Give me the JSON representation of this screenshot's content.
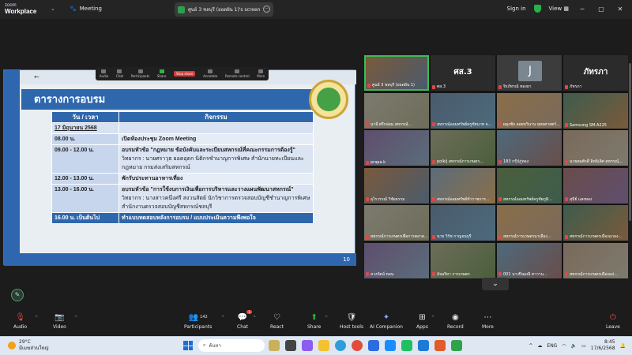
{
  "titlebar": {
    "logo_line1": "zoom",
    "logo_line2": "Workplace",
    "meeting_label": "Meeting",
    "share_tab": "ศูนย์ 3 ชลบุรี (ยอดฝัน 1)'s screen",
    "signin": "Sign in",
    "view": "View"
  },
  "slide": {
    "title": "ตารางการอบรม",
    "headers": [
      "วัน / เวลา",
      "กิจกรรม"
    ],
    "date": "17 มิถุนายน 2568",
    "page_number": "10",
    "rows": [
      {
        "time": "08.00 น.",
        "activity": "เปิดห้องประชุม Zoom Meeting",
        "detail": ""
      },
      {
        "time": "09.00 - 12.00 น.",
        "activity": "อบรมหัวข้อ \"กฎหมาย ข้อบังคับและระเบียบสหกรณ์ที่คณะกรรมการต้องรู้\"",
        "detail": "วิทยากร : นายศราวุธ ยอดอุดก นิติกรชำนาญการพิเศษ สำนักนายทะเบียนและกฎหมาย กรมส่งเสริมสหกรณ์"
      },
      {
        "time": "12.00 - 13.00 น.",
        "activity": "พักรับประทานอาหารเที่ยง",
        "detail": ""
      },
      {
        "time": "13.00 - 16.00 น.",
        "activity": "อบรมหัวข้อ \"การใช้งบการเงินเพื่อการบริหารและวางแผนพัฒนาสหกรณ์\"",
        "detail": "วิทยากร : นางสาวคนึงศรี สงวนสัตย์ นักวิชาการตรวจสอบบัญชีชำนาญการพิเศษ สำนักงานตรวจสอบบัญชีสหกรณ์ชลบุรี"
      },
      {
        "time": "16.00 น. เป็นต้นไป",
        "activity": "ทำแบบทดสอบหลังการอบรม / แบบประเมินความพึงพอใจ",
        "detail": ""
      }
    ]
  },
  "sharebar": {
    "items": [
      "Audio",
      "Chat",
      "Participants",
      "Share",
      "Stop share",
      "Annotate",
      "Remote control",
      "More"
    ]
  },
  "gallery": {
    "tiles": [
      {
        "name": "ศูนย์ 3 ชลบุรี (ยอดฝัน 1)",
        "big": "",
        "kind": "video"
      },
      {
        "name": "ศส.3",
        "big": "ศส.3",
        "kind": "text"
      },
      {
        "name": "จิรภัทรณ์ ทองยา",
        "big": "J",
        "kind": "avatar"
      },
      {
        "name": "ภัทรภา",
        "big": "ภัทรภา",
        "kind": "text"
      },
      {
        "name": "นาลี ศรีกล่อม สหกรณ์...",
        "big": "",
        "kind": "video"
      },
      {
        "name": "สหกรณ์ออมทรัพย์ครูชัยนาท จ...",
        "big": "",
        "kind": "video"
      },
      {
        "name": "ผดุงชัย ลอยทวินาน ยุทธศาสตร์...",
        "big": "",
        "kind": "video"
      },
      {
        "name": "Samsung SM-A225",
        "big": "",
        "kind": "video"
      },
      {
        "name": "prapa.k",
        "big": "",
        "kind": "video"
      },
      {
        "name": "polkij สหกรณ์การเกษตร...",
        "big": "",
        "kind": "video"
      },
      {
        "name": "183 กรุ๊ปภู่ทอง",
        "big": "",
        "kind": "video"
      },
      {
        "name": "นายสมศักดิ์ อิทธิเลิศ สหกรณ์...",
        "big": "",
        "kind": "video"
      },
      {
        "name": "อุไรวรรณ์ วิชัยธรรม",
        "big": "",
        "kind": "video"
      },
      {
        "name": "สหกรณ์ออมทรัพย์ข้าราชการ...",
        "big": "",
        "kind": "video"
      },
      {
        "name": "สหกรณ์ออมทรัพย์ครูชัยภูมิ...",
        "big": "",
        "kind": "video"
      },
      {
        "name": "สุนีย์ แสงทอง",
        "big": "",
        "kind": "video"
      },
      {
        "name": "สหกรณ์การเกษตรเพื่อการตลาด...",
        "big": "",
        "kind": "video"
      },
      {
        "name": "นาย วิรัช กาญจนบุรี",
        "big": "",
        "kind": "video"
      },
      {
        "name": "สหกรณ์การเกษตรนาเมือง...",
        "big": "",
        "kind": "video"
      },
      {
        "name": "สหกรณ์การเกษตรเมืองแกลง...",
        "big": "",
        "kind": "video"
      },
      {
        "name": "ควงรัตน์ ทอน",
        "big": "",
        "kind": "video"
      },
      {
        "name": "อัจฉริยา การเกษตร",
        "big": "",
        "kind": "video"
      },
      {
        "name": "001 นางปิ่นมณี ทาวาน...",
        "big": "",
        "kind": "video"
      },
      {
        "name": "สหกรณ์การเกษตรเมืองแม่...",
        "big": "",
        "kind": "video"
      }
    ]
  },
  "toolbar": {
    "audio": "Audio",
    "video": "Video",
    "participants": "Participants",
    "participants_count": "142",
    "chat": "Chat",
    "chat_badge": "1",
    "react": "React",
    "share": "Share",
    "host_tools": "Host tools",
    "ai_companion": "AI Companion",
    "apps": "Apps",
    "record": "Record",
    "more": "More",
    "leave": "Leave"
  },
  "taskbar": {
    "temp": "29°C",
    "weather_text": "มีเมฆส่วนใหญ่",
    "search_placeholder": "ค้นหา",
    "lang": "ENG",
    "time": "8:45",
    "date": "17/6/2568"
  },
  "colors": {
    "slide_blue": "#2f67ad",
    "active_speaker": "#3dbb55",
    "leave": "#e04848"
  }
}
